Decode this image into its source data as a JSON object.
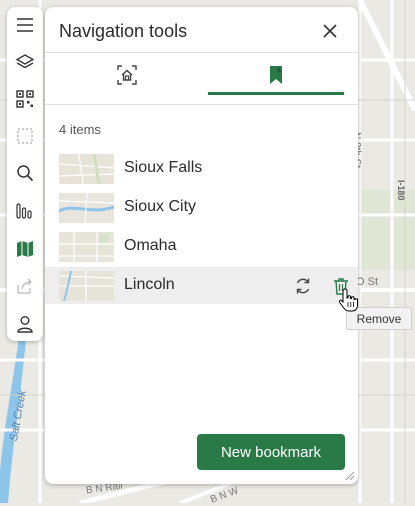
{
  "map": {
    "street_labels": {
      "n8th": "N 8th St",
      "salt_creek": "Salt Creek",
      "bn_rail": "B N Rail",
      "bn_w": "B N W",
      "o_st": "O St",
      "i180": "I-180"
    }
  },
  "toolbar": {
    "items": [
      {
        "icon": "hamburger-menu-icon"
      },
      {
        "icon": "layers-icon"
      },
      {
        "icon": "qr-code-icon"
      },
      {
        "icon": "select-area-icon"
      },
      {
        "icon": "search-icon"
      },
      {
        "icon": "bar-chart-icon"
      },
      {
        "icon": "map-icon",
        "active": true
      },
      {
        "icon": "share-icon",
        "disabled": true
      },
      {
        "icon": "user-icon"
      }
    ]
  },
  "panel": {
    "title": "Navigation tools",
    "tabs": [
      {
        "icon": "home-extent-icon",
        "active": false
      },
      {
        "icon": "bookmark-icon",
        "active": true
      }
    ],
    "count_text": "4 items",
    "bookmarks": [
      {
        "label": "Sioux Falls"
      },
      {
        "label": "Sioux City"
      },
      {
        "label": "Omaha"
      },
      {
        "label": "Lincoln",
        "hovered": true
      }
    ],
    "new_button_label": "New bookmark"
  },
  "tooltip": {
    "text": "Remove"
  },
  "colors": {
    "accent": "#2a7a48",
    "map_bg": "#ebe9e3",
    "road": "#ffffff",
    "water": "#8cc4ea",
    "park": "#cfe0c1"
  }
}
